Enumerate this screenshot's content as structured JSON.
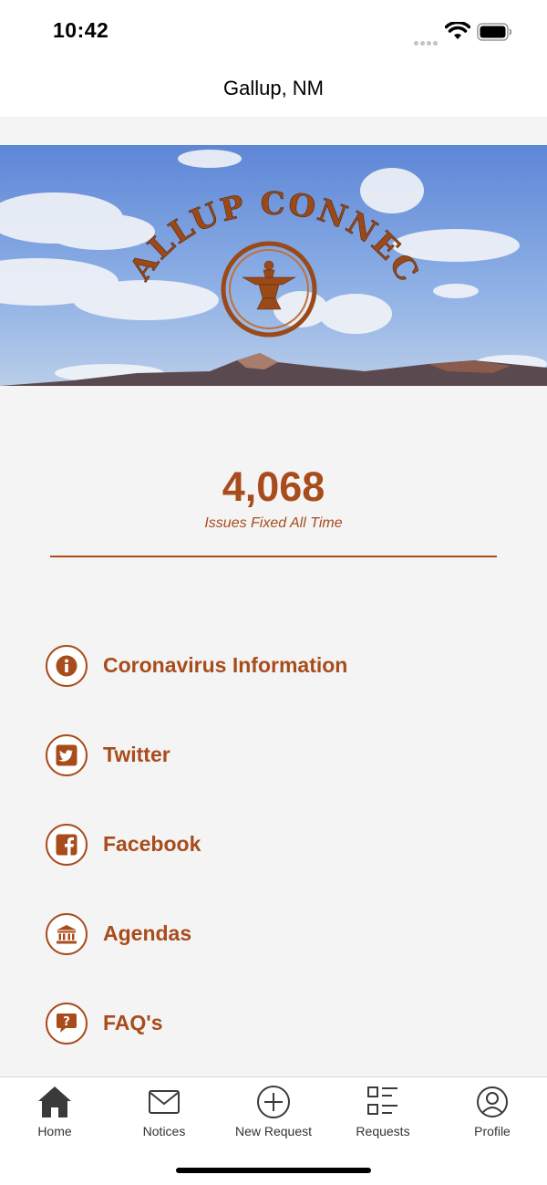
{
  "status_bar": {
    "time": "10:42"
  },
  "nav": {
    "title": "Gallup, NM"
  },
  "hero": {
    "logo_text": "GALLUP CONNECT"
  },
  "stats": {
    "value": "4,068",
    "label": "Issues Fixed All Time"
  },
  "links": [
    {
      "label": "Coronavirus Information",
      "icon": "info-icon"
    },
    {
      "label": "Twitter",
      "icon": "twitter-icon"
    },
    {
      "label": "Facebook",
      "icon": "facebook-icon"
    },
    {
      "label": "Agendas",
      "icon": "government-building-icon"
    },
    {
      "label": "FAQ's",
      "icon": "question-bubble-icon"
    }
  ],
  "tabs": [
    {
      "label": "Home",
      "icon": "home-icon",
      "active": true
    },
    {
      "label": "Notices",
      "icon": "envelope-icon"
    },
    {
      "label": "New Request",
      "icon": "plus-circle-icon"
    },
    {
      "label": "Requests",
      "icon": "list-icon"
    },
    {
      "label": "Profile",
      "icon": "profile-icon"
    }
  ],
  "colors": {
    "accent": "#a84c1c",
    "background": "#f4f4f4",
    "tab_bar": "#ffffff"
  }
}
